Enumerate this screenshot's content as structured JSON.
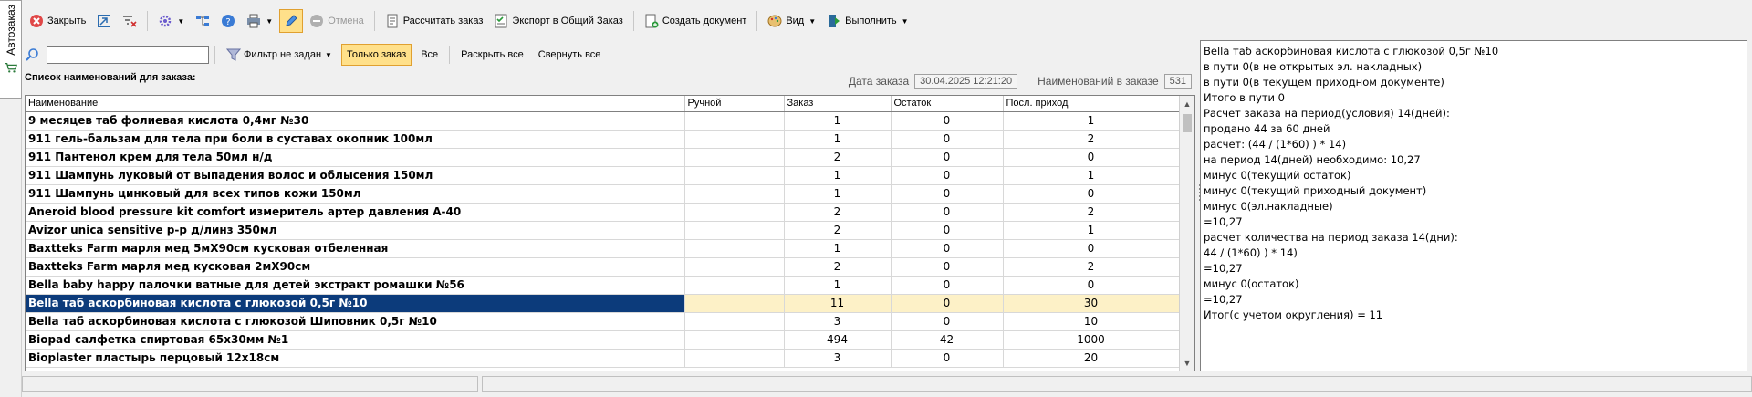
{
  "side_tab": {
    "label": "Автозаказ"
  },
  "toolbar": {
    "close_label": "Закрыть",
    "cancel_label": "Отмена",
    "calc_label": "Рассчитать заказ",
    "export_label": "Экспорт в Общий Заказ",
    "create_doc_label": "Создать документ",
    "view_label": "Вид",
    "execute_label": "Выполнить"
  },
  "filter": {
    "search_value": "",
    "filter_label": "Фильтр не задан",
    "only_order_label": "Только заказ",
    "all_label": "Все",
    "expand_all_label": "Раскрыть все",
    "collapse_all_label": "Свернуть все"
  },
  "list_title": "Список наименований для заказа:",
  "info": {
    "date_label": "Дата заказа",
    "date_value": "30.04.2025 12:21:20",
    "count_label": "Наименований в заказе",
    "count_value": "531"
  },
  "table": {
    "headers": [
      "Наименование",
      "Ручной",
      "Заказ",
      "Остаток",
      "Посл. приход"
    ],
    "rows": [
      {
        "name": "9 месяцев таб фолиевая кислота 0,4мг №30",
        "manual": "",
        "order": "1",
        "stock": "0",
        "last": "1"
      },
      {
        "name": "911 гель-бальзам для тела при боли в суставах окопник 100мл",
        "manual": "",
        "order": "1",
        "stock": "0",
        "last": "2"
      },
      {
        "name": "911 Пантенол крем для тела 50мл н/д",
        "manual": "",
        "order": "2",
        "stock": "0",
        "last": "0"
      },
      {
        "name": "911 Шампунь луковый от выпадения волос и облысения 150мл",
        "manual": "",
        "order": "1",
        "stock": "0",
        "last": "1"
      },
      {
        "name": "911 Шампунь цинковый для всех типов кожи 150мл",
        "manual": "",
        "order": "1",
        "stock": "0",
        "last": "0"
      },
      {
        "name": "Aneroid blood pressure kit comfort измеритель артер давления А-40",
        "manual": "",
        "order": "2",
        "stock": "0",
        "last": "2"
      },
      {
        "name": "Avizor unica sensitive р-р д/линз 350мл",
        "manual": "",
        "order": "2",
        "stock": "0",
        "last": "1"
      },
      {
        "name": "Baxtteks Farm марля мед 5мХ90см кусковая отбеленная",
        "manual": "",
        "order": "1",
        "stock": "0",
        "last": "0"
      },
      {
        "name": "Baxtteks Farm марля мед кусковая 2мХ90см",
        "manual": "",
        "order": "2",
        "stock": "0",
        "last": "2"
      },
      {
        "name": "Bella baby happy палочки ватные для детей экстракт ромашки №56",
        "manual": "",
        "order": "1",
        "stock": "0",
        "last": "0"
      },
      {
        "name": "Bella таб аскорбиновая кислота с глюкозой 0,5г №10",
        "manual": "",
        "order": "11",
        "stock": "0",
        "last": "30",
        "selected": true
      },
      {
        "name": "Bella таб аскорбиновая кислота с глюкозой Шиповник 0,5г №10",
        "manual": "",
        "order": "3",
        "stock": "0",
        "last": "10"
      },
      {
        "name": "Biopad салфетка спиртовая 65х30мм №1",
        "manual": "",
        "order": "494",
        "stock": "42",
        "last": "1000"
      },
      {
        "name": "Bioplaster пластырь перцовый 12х18см",
        "manual": "",
        "order": "3",
        "stock": "0",
        "last": "20"
      }
    ]
  },
  "detail_text": "Bella таб аскорбиновая кислота с глюкозой 0,5г №10\nв пути 0(в не открытых эл. накладных)\nв пути 0(в текущем приходном документе)\nИтого в пути 0\nРасчет заказа на период(условия) 14(дней):\nпродано 44 за 60 дней\nрасчет: (44 / (1*60) ) * 14)\nна период 14(дней) необходимо: 10,27\nминус 0(текущий остаток)\nминус 0(текущий приходный документ)\nминус 0(эл.накладные)\n=10,27\nрасчет количества на период заказа 14(дни):\n44 / (1*60) ) * 14)\n=10,27\nминус 0(остаток)\n=10,27\nИтог(с учетом округления) = 11"
}
